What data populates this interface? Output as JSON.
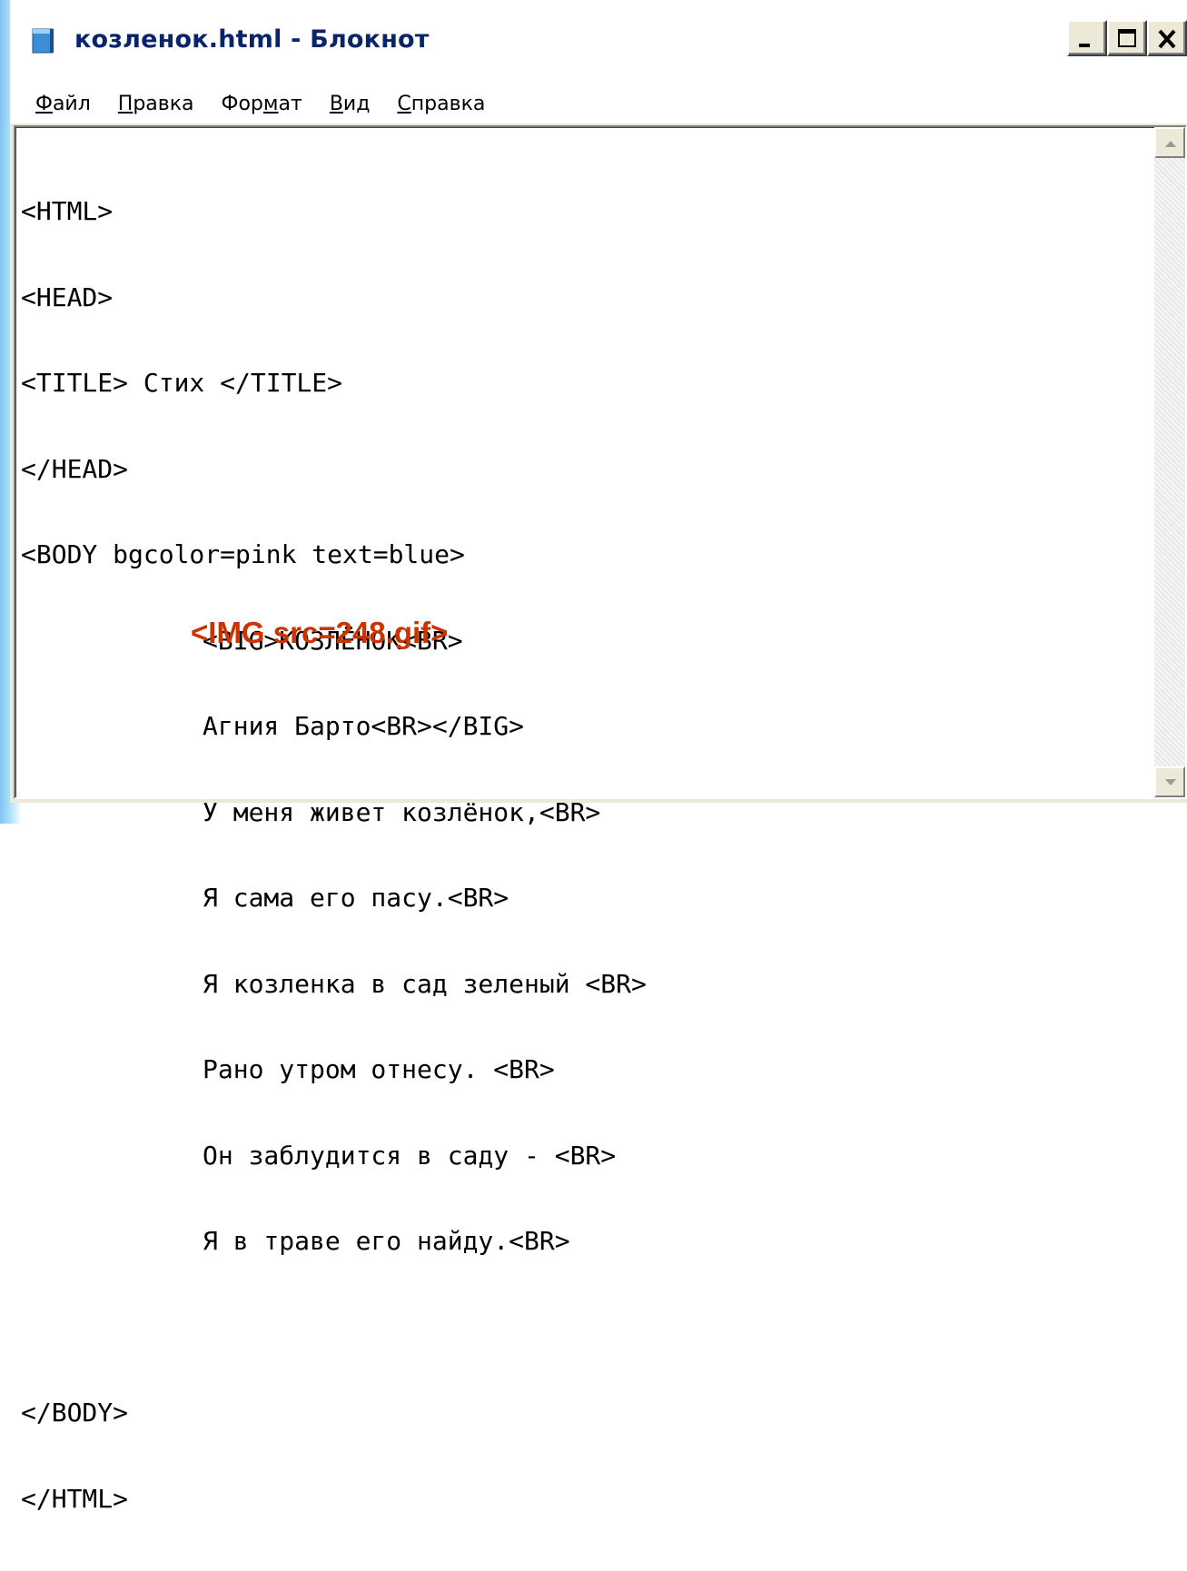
{
  "window": {
    "title": "козленок.html - Блокнот",
    "icon": "notepad-icon",
    "controls": {
      "minimize_icon": "minimize-icon",
      "maximize_icon": "maximize-icon",
      "close_icon": "close-icon"
    }
  },
  "menu": {
    "items": [
      {
        "prefix": "",
        "underline": "Ф",
        "rest": "айл"
      },
      {
        "prefix": "",
        "underline": "П",
        "rest": "равка"
      },
      {
        "prefix": "Фор",
        "underline": "м",
        "rest": "ат"
      },
      {
        "prefix": "",
        "underline": "В",
        "rest": "ид"
      },
      {
        "prefix": "",
        "underline": "С",
        "rest": "правка"
      }
    ]
  },
  "editor": {
    "lines": [
      "<HTML>",
      "<HEAD>",
      "<TITLE> Стих </TITLE>",
      "</HEAD>",
      "<BODY bgcolor=pink text=blue>",
      "<BIG>КОЗЛЁНОК<BR>",
      "Агния Барто<BR></BIG>",
      "У меня живет козлёнок,<BR>",
      "Я сама его пасу.<BR>",
      "Я козленка в сад зеленый <BR>",
      "Рано утром отнесу. <BR>",
      "Он заблудится в саду - <BR>",
      "Я в траве его найду.<BR>",
      "",
      "</BODY>",
      "</HTML>"
    ],
    "inserted_line": "<IMG src=248.gif>",
    "inserted_color": "#cc3300"
  },
  "scrollbar": {
    "up_icon": "scroll-up-arrow-icon",
    "down_icon": "scroll-down-arrow-icon"
  }
}
